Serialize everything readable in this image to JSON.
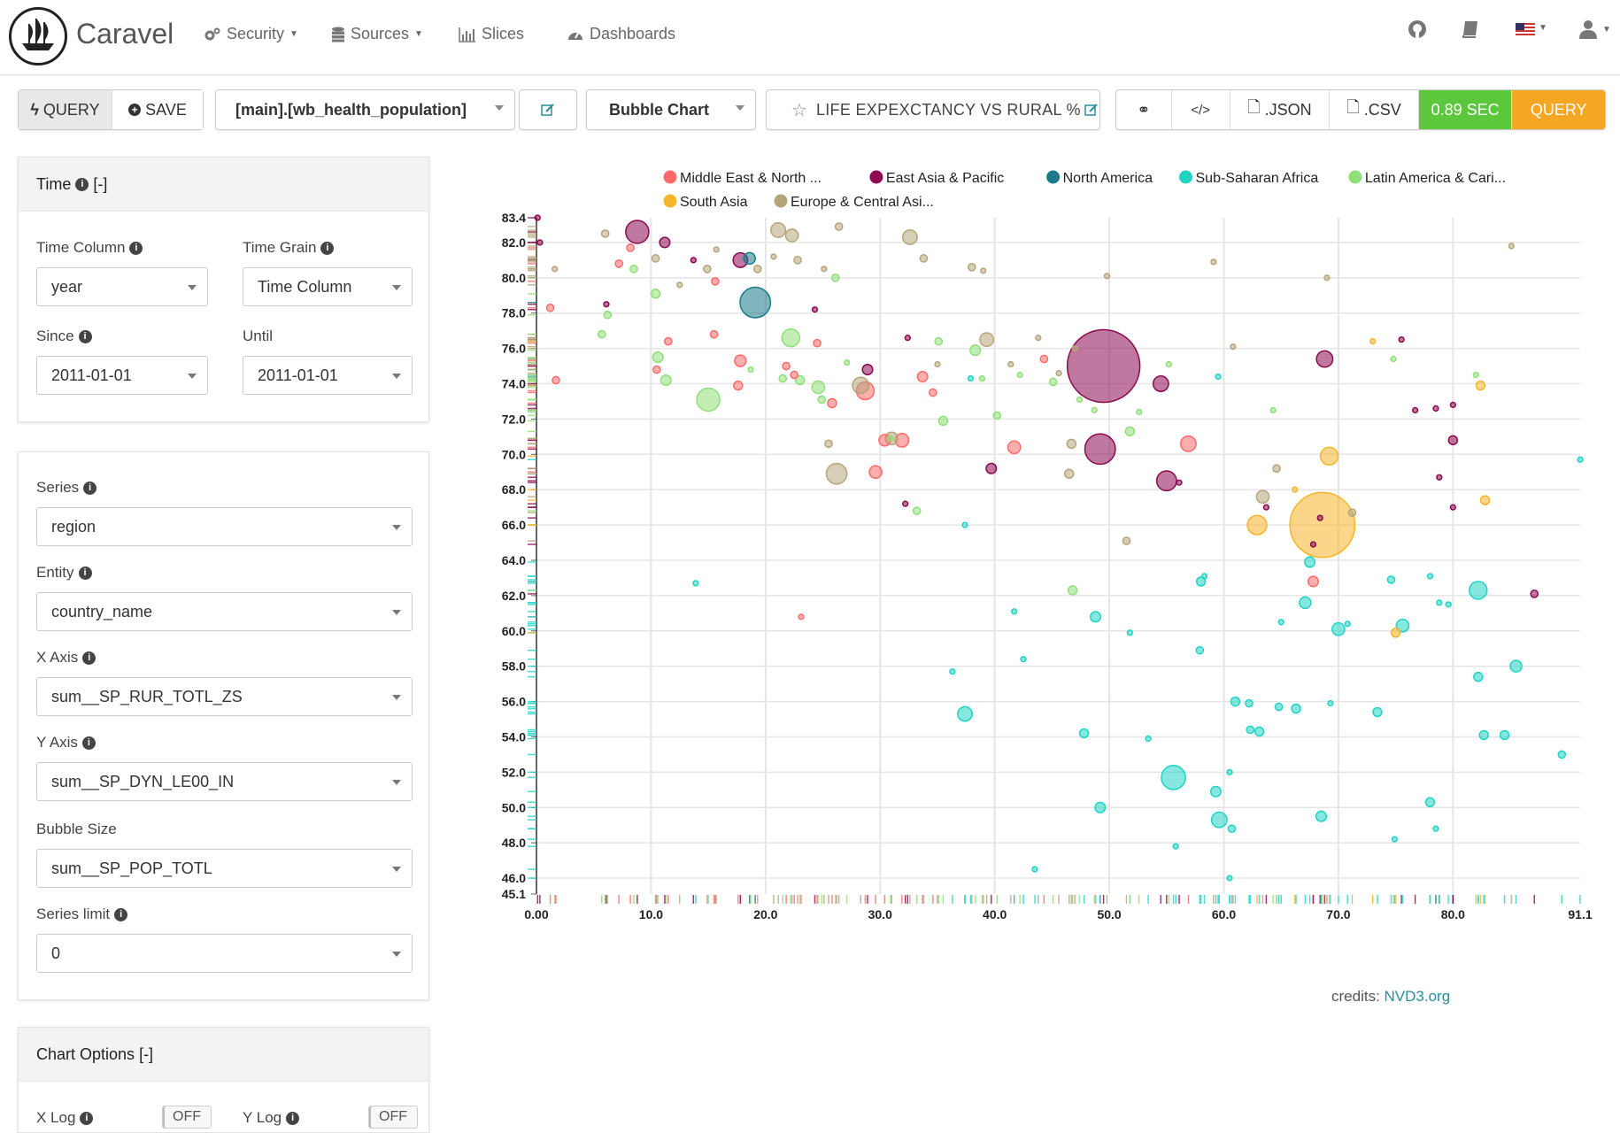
{
  "nav": {
    "brand": "Caravel",
    "items": [
      {
        "label": "Security",
        "icon": "gears-icon"
      },
      {
        "label": "Sources",
        "icon": "database-icon"
      },
      {
        "label": "Slices",
        "icon": "bar-chart-icon"
      },
      {
        "label": "Dashboards",
        "icon": "dashboard-icon"
      }
    ]
  },
  "toolbar": {
    "query_label": "QUERY",
    "save_label": "SAVE",
    "datasource": "[main].[wb_health_population]",
    "viz_type": "Bubble Chart",
    "slice_title": "LIFE EXPEXCTANCY VS RURAL %",
    "json_label": ".JSON",
    "csv_label": ".CSV",
    "timer": "0.89 SEC",
    "run_label": "QUERY",
    "colors": {
      "timer": "#5cc73c",
      "run": "#f5a623"
    }
  },
  "time_panel": {
    "title": "Time",
    "collapse": "[-]",
    "time_column_label": "Time Column",
    "time_column_value": "year",
    "time_grain_label": "Time Grain",
    "time_grain_value": "Time Column",
    "since_label": "Since",
    "since_value": "2011-01-01",
    "until_label": "Until",
    "until_value": "2011-01-01"
  },
  "query_panel": {
    "series_label": "Series",
    "series_value": "region",
    "entity_label": "Entity",
    "entity_value": "country_name",
    "x_label": "X Axis",
    "x_value": "sum__SP_RUR_TOTL_ZS",
    "y_label": "Y Axis",
    "y_value": "sum__SP_DYN_LE00_IN",
    "size_label": "Bubble Size",
    "size_value": "sum__SP_POP_TOTL",
    "limit_label": "Series limit",
    "limit_value": "0"
  },
  "chart_options": {
    "title": "Chart Options",
    "collapse": "[-]",
    "xlog_label": "X Log",
    "xlog_value": "OFF",
    "ylog_label": "Y Log",
    "ylog_value": "OFF"
  },
  "credits": {
    "prefix": "credits:",
    "link": "NVD3.org"
  },
  "chart_data": {
    "type": "scatter",
    "xlabel": "",
    "ylabel": "",
    "xlim": [
      0,
      91.1
    ],
    "ylim": [
      45.1,
      83.4
    ],
    "x_ticks": [
      "0.00",
      "10.0",
      "20.0",
      "30.0",
      "40.0",
      "50.0",
      "60.0",
      "70.0",
      "80.0",
      "91.1"
    ],
    "y_ticks": [
      "45.1",
      "46.0",
      "48.0",
      "50.0",
      "52.0",
      "54.0",
      "56.0",
      "58.0",
      "60.0",
      "62.0",
      "64.0",
      "66.0",
      "68.0",
      "70.0",
      "72.0",
      "74.0",
      "76.0",
      "78.0",
      "80.0",
      "82.0",
      "83.4"
    ],
    "grid": true,
    "legend_position": "top",
    "series": [
      {
        "name": "Middle East & North ...",
        "color": "#ff6b6b",
        "points": [
          [
            1.2,
            78.3
          ],
          [
            1.7,
            74.2
          ],
          [
            8.2,
            81.7
          ],
          [
            7.2,
            80.8
          ],
          [
            10.5,
            74.8
          ],
          [
            11.5,
            76.4
          ],
          [
            15.6,
            79.8
          ],
          [
            15.5,
            76.8
          ],
          [
            17.6,
            73.9
          ],
          [
            17.8,
            75.3
          ],
          [
            21.8,
            75.0
          ],
          [
            22.5,
            74.5
          ],
          [
            24.5,
            76.3
          ],
          [
            25.8,
            72.9
          ],
          [
            28.7,
            73.6
          ],
          [
            30.4,
            70.8
          ],
          [
            31.9,
            70.8
          ],
          [
            29.6,
            69.0
          ],
          [
            33.7,
            74.4
          ],
          [
            34.6,
            73.5
          ],
          [
            41.7,
            70.4
          ],
          [
            44.3,
            75.4
          ],
          [
            56.9,
            70.6
          ],
          [
            67.8,
            62.8
          ],
          [
            23.1,
            60.8
          ]
        ],
        "sizes": [
          2,
          2,
          2,
          2,
          2,
          2,
          2,
          2,
          3,
          5,
          2,
          2,
          2,
          3,
          12,
          5,
          7,
          6,
          4,
          2,
          6,
          2,
          9,
          4,
          1
        ]
      },
      {
        "name": "East Asia & Pacific",
        "color": "#8b0a50",
        "points": [
          [
            0.1,
            83.4
          ],
          [
            0.3,
            82.0
          ],
          [
            6.1,
            78.5
          ],
          [
            8.8,
            82.6
          ],
          [
            11.2,
            82.0
          ],
          [
            13.7,
            81.0
          ],
          [
            17.8,
            81.0
          ],
          [
            24.3,
            78.2
          ],
          [
            28.9,
            74.8
          ],
          [
            32.2,
            67.2
          ],
          [
            32.4,
            76.6
          ],
          [
            39.7,
            69.2
          ],
          [
            49.5,
            75.0
          ],
          [
            49.2,
            70.3
          ],
          [
            54.5,
            74.0
          ],
          [
            55.0,
            68.5
          ],
          [
            56.1,
            68.4
          ],
          [
            63.7,
            67.0
          ],
          [
            67.8,
            64.9
          ],
          [
            68.4,
            66.4
          ],
          [
            68.8,
            75.4
          ],
          [
            75.5,
            76.5
          ],
          [
            76.7,
            72.5
          ],
          [
            78.8,
            68.7
          ],
          [
            78.5,
            72.6
          ],
          [
            80.0,
            67.0
          ],
          [
            80.0,
            70.8
          ],
          [
            80.0,
            72.8
          ],
          [
            87.1,
            62.1
          ]
        ],
        "sizes": [
          1,
          1,
          1,
          20,
          4,
          1,
          8,
          1,
          4,
          1,
          1,
          4,
          200,
          35,
          9,
          15,
          1,
          1,
          1,
          1,
          10,
          1,
          1,
          1,
          1,
          1,
          3,
          1,
          2
        ]
      },
      {
        "name": "North America",
        "color": "#1a7a8a",
        "points": [
          [
            18.6,
            81.1
          ],
          [
            19.1,
            78.6
          ]
        ],
        "sizes": [
          5,
          35
        ]
      },
      {
        "name": "Sub-Saharan Africa",
        "color": "#22d3c5",
        "points": [
          [
            13.9,
            62.7
          ],
          [
            37.4,
            55.3
          ],
          [
            36.3,
            57.7
          ],
          [
            37.9,
            74.3
          ],
          [
            37.4,
            66.0
          ],
          [
            41.7,
            61.1
          ],
          [
            42.5,
            58.4
          ],
          [
            43.5,
            46.5
          ],
          [
            47.8,
            54.2
          ],
          [
            48.8,
            60.8
          ],
          [
            49.2,
            50.0
          ],
          [
            51.8,
            59.9
          ],
          [
            53.4,
            53.9
          ],
          [
            55.6,
            51.7
          ],
          [
            55.8,
            47.8
          ],
          [
            57.9,
            58.9
          ],
          [
            58.0,
            62.8
          ],
          [
            58.3,
            63.1
          ],
          [
            59.3,
            50.9
          ],
          [
            59.6,
            49.3
          ],
          [
            60.5,
            52.0
          ],
          [
            60.7,
            48.8
          ],
          [
            61.0,
            56.0
          ],
          [
            62.2,
            55.9
          ],
          [
            62.3,
            54.4
          ],
          [
            63.1,
            54.3
          ],
          [
            64.8,
            55.7
          ],
          [
            65.0,
            60.5
          ],
          [
            66.3,
            55.6
          ],
          [
            67.1,
            61.6
          ],
          [
            67.5,
            63.9
          ],
          [
            68.5,
            49.5
          ],
          [
            69.3,
            55.9
          ],
          [
            70.0,
            60.1
          ],
          [
            70.8,
            60.4
          ],
          [
            73.4,
            55.4
          ],
          [
            74.6,
            62.9
          ],
          [
            74.9,
            48.2
          ],
          [
            75.6,
            60.3
          ],
          [
            78.0,
            63.1
          ],
          [
            78.0,
            50.3
          ],
          [
            78.5,
            48.8
          ],
          [
            78.8,
            61.6
          ],
          [
            79.6,
            61.5
          ],
          [
            82.2,
            62.3
          ],
          [
            82.2,
            57.4
          ],
          [
            82.7,
            54.1
          ],
          [
            84.5,
            54.1
          ],
          [
            85.5,
            58.0
          ],
          [
            89.5,
            53.0
          ],
          [
            91.1,
            69.7
          ],
          [
            60.5,
            46.0
          ],
          [
            59.5,
            74.4
          ]
        ],
        "sizes": [
          1,
          8,
          1,
          1,
          1,
          1,
          1,
          1,
          3,
          4,
          4,
          1,
          1,
          22,
          1,
          2,
          3,
          1,
          4,
          9,
          1,
          2,
          3,
          2,
          2,
          3,
          2,
          1,
          3,
          5,
          4,
          4,
          1,
          6,
          1,
          3,
          2,
          1,
          6,
          1,
          3,
          1,
          1,
          1,
          12,
          3,
          3,
          3,
          5,
          2,
          1,
          1,
          1
        ]
      },
      {
        "name": "Latin America & Cari...",
        "color": "#90e07a",
        "points": [
          [
            5.7,
            76.8
          ],
          [
            6.2,
            77.9
          ],
          [
            8.5,
            80.5
          ],
          [
            10.4,
            79.1
          ],
          [
            10.6,
            75.5
          ],
          [
            11.3,
            74.2
          ],
          [
            15.0,
            73.1
          ],
          [
            18.7,
            74.8
          ],
          [
            21.5,
            74.3
          ],
          [
            22.2,
            76.6
          ],
          [
            23.0,
            74.2
          ],
          [
            24.6,
            73.8
          ],
          [
            24.9,
            73.1
          ],
          [
            26.1,
            80.0
          ],
          [
            27.1,
            75.2
          ],
          [
            30.9,
            70.9
          ],
          [
            33.2,
            66.8
          ],
          [
            35.1,
            76.4
          ],
          [
            35.5,
            71.9
          ],
          [
            38.3,
            75.9
          ],
          [
            38.9,
            74.3
          ],
          [
            40.2,
            72.2
          ],
          [
            42.2,
            74.5
          ],
          [
            45.1,
            74.1
          ],
          [
            46.8,
            62.3
          ],
          [
            47.4,
            73.1
          ],
          [
            48.7,
            72.5
          ],
          [
            51.8,
            71.3
          ],
          [
            52.6,
            72.4
          ],
          [
            55.2,
            75.1
          ],
          [
            64.3,
            72.5
          ],
          [
            74.8,
            75.4
          ],
          [
            82.0,
            74.5
          ]
        ],
        "sizes": [
          2,
          2,
          2,
          3,
          4,
          4,
          20,
          1,
          2,
          12,
          3,
          6,
          2,
          2,
          1,
          1,
          2,
          2,
          3,
          4,
          1,
          2,
          1,
          2,
          3,
          1,
          1,
          3,
          1,
          1,
          1,
          1,
          1
        ]
      },
      {
        "name": "South Asia",
        "color": "#f7b52a",
        "points": [
          [
            62.9,
            66.0
          ],
          [
            66.2,
            68.0
          ],
          [
            68.6,
            66.0
          ],
          [
            69.2,
            69.9
          ],
          [
            75.0,
            59.9
          ],
          [
            82.4,
            73.9
          ],
          [
            82.8,
            67.4
          ],
          [
            73.0,
            76.4
          ]
        ],
        "sizes": [
          14,
          1,
          160,
          12,
          3,
          3,
          3,
          1
        ]
      },
      {
        "name": "Europe & Central Asi...",
        "color": "#b5a57b",
        "points": [
          [
            1.6,
            80.5
          ],
          [
            6.0,
            82.5
          ],
          [
            10.4,
            81.1
          ],
          [
            12.5,
            79.6
          ],
          [
            14.9,
            80.5
          ],
          [
            15.7,
            81.6
          ],
          [
            19.3,
            80.5
          ],
          [
            20.7,
            81.2
          ],
          [
            21.1,
            82.7
          ],
          [
            22.3,
            82.4
          ],
          [
            22.8,
            81.0
          ],
          [
            25.1,
            80.5
          ],
          [
            26.4,
            82.9
          ],
          [
            28.3,
            73.9
          ],
          [
            31.0,
            70.9
          ],
          [
            32.6,
            82.3
          ],
          [
            33.8,
            81.1
          ],
          [
            35.0,
            75.1
          ],
          [
            38.0,
            80.6
          ],
          [
            39.0,
            80.4
          ],
          [
            39.3,
            76.5
          ],
          [
            41.4,
            75.1
          ],
          [
            43.8,
            76.6
          ],
          [
            45.6,
            74.6
          ],
          [
            46.5,
            68.9
          ],
          [
            46.7,
            70.6
          ],
          [
            47.0,
            76.0
          ],
          [
            49.8,
            80.1
          ],
          [
            51.5,
            65.1
          ],
          [
            59.1,
            80.9
          ],
          [
            60.8,
            76.1
          ],
          [
            63.4,
            67.6
          ],
          [
            64.6,
            69.2
          ],
          [
            69.0,
            80.0
          ],
          [
            71.2,
            66.7
          ],
          [
            85.1,
            81.8
          ],
          [
            25.5,
            70.6
          ],
          [
            26.2,
            68.9
          ]
        ],
        "sizes": [
          1,
          2,
          2,
          1,
          2,
          1,
          2,
          1,
          8,
          6,
          2,
          1,
          2,
          10,
          6,
          8,
          2,
          1,
          2,
          1,
          7,
          1,
          1,
          1,
          3,
          3,
          1,
          1,
          2,
          1,
          1,
          6,
          2,
          1,
          2,
          1,
          2,
          16
        ]
      }
    ]
  }
}
